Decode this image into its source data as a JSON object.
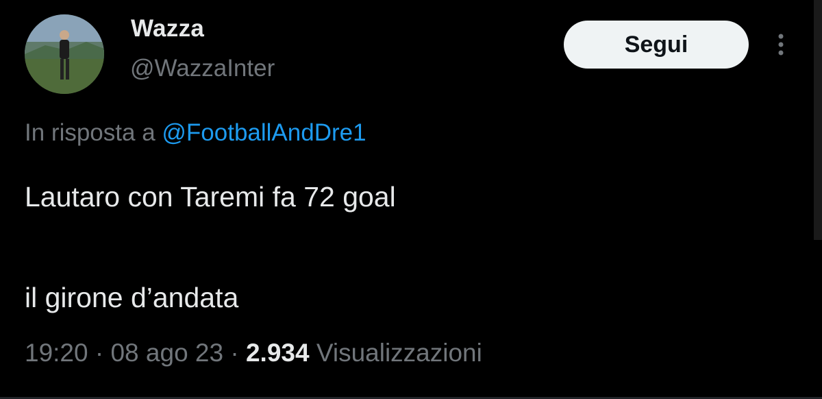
{
  "author": {
    "name": "Wazza",
    "handle": "@WazzaInter",
    "avatar": "profile-photo"
  },
  "follow_button": {
    "label": "Segui"
  },
  "more_icon": "more-vertical-icon",
  "reply": {
    "prefix": "In risposta a",
    "to": "@FootballAndDre1"
  },
  "tweet": {
    "line1": "Lautaro con Taremi fa 72 goal",
    "line2": "il girone d’andata"
  },
  "meta": {
    "time": "19:20",
    "date": "08 ago 23",
    "views_count": "2.934",
    "views_label": "Visualizzazioni"
  },
  "colors": {
    "background": "#000000",
    "text_primary": "#e7e9ea",
    "text_secondary": "#71767b",
    "link": "#1d9bf0",
    "button_bg": "#eff3f4"
  }
}
